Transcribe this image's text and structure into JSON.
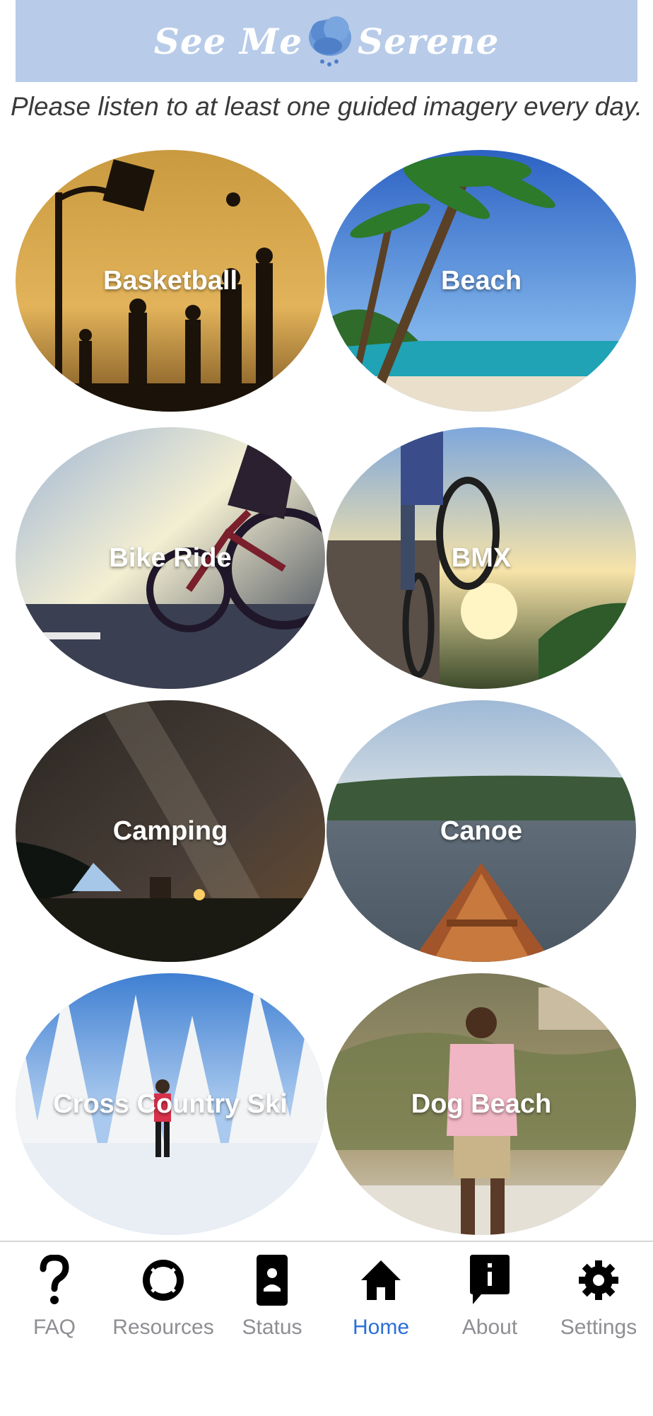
{
  "header": {
    "logo_left": "See Me",
    "logo_right": "Serene"
  },
  "subtitle": "Please listen to at least one guided imagery every day.",
  "cards": [
    {
      "label": "Basketball"
    },
    {
      "label": "Beach"
    },
    {
      "label": "Bike Ride"
    },
    {
      "label": "BMX"
    },
    {
      "label": "Camping"
    },
    {
      "label": "Canoe"
    },
    {
      "label": "Cross Country Ski"
    },
    {
      "label": "Dog Beach"
    }
  ],
  "tabs": [
    {
      "label": "FAQ",
      "icon": "question-icon"
    },
    {
      "label": "Resources",
      "icon": "lifebuoy-icon"
    },
    {
      "label": "Status",
      "icon": "contact-card-icon"
    },
    {
      "label": "Home",
      "icon": "home-icon",
      "active": true
    },
    {
      "label": "About",
      "icon": "info-chat-icon"
    },
    {
      "label": "Settings",
      "icon": "gear-icon"
    }
  ],
  "colors": {
    "header_bg": "#b8cce9",
    "active_tab": "#2a6fd6",
    "inactive_tab": "#8e8e93"
  }
}
